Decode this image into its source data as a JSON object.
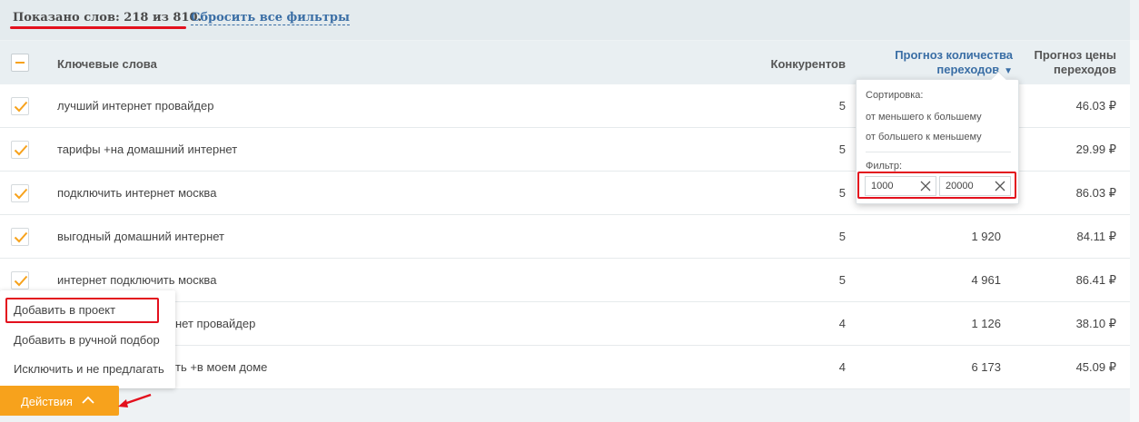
{
  "summary": {
    "shown_label": "Показано слов: 218 из 810.",
    "reset_filters": "Сбросить все фильтры"
  },
  "table": {
    "headers": {
      "keywords": "Ключевые слова",
      "competitors": "Конкурентов",
      "traffic_line1": "Прогноз количества",
      "traffic_line2": "переходов",
      "price_line1": "Прогноз цены",
      "price_line2": "переходов"
    },
    "rows": [
      {
        "keyword": "лучший интернет провайдер",
        "competitors": "5",
        "traffic": "",
        "price": "46.03 ₽"
      },
      {
        "keyword": "тарифы +на домашний интернет",
        "competitors": "5",
        "traffic": "",
        "price": "29.99 ₽"
      },
      {
        "keyword": "подключить интернет москва",
        "competitors": "5",
        "traffic": "",
        "price": "86.03 ₽"
      },
      {
        "keyword": "выгодный домашний интернет",
        "competitors": "5",
        "traffic": "1 920",
        "price": "84.11 ₽"
      },
      {
        "keyword": "интернет подключить москва",
        "competitors": "5",
        "traffic": "4 961",
        "price": "86.41 ₽"
      },
      {
        "keyword": "нет провайдер",
        "competitors": "4",
        "traffic": "1 126",
        "price": "38.10 ₽"
      },
      {
        "keyword": "ть +в моем доме",
        "competitors": "4",
        "traffic": "6 173",
        "price": "45.09 ₽"
      }
    ]
  },
  "sort_popover": {
    "sort_label": "Сортировка:",
    "asc": "от меньшего к большему",
    "desc": "от большего к меньшему",
    "filter_label": "Фильтр:",
    "min_value": "1000",
    "max_value": "20000"
  },
  "actions_menu": {
    "items": [
      "Добавить в проект",
      "Добавить в ручной подбор",
      "Исключить и не предлагать"
    ],
    "button_label": "Действия"
  },
  "colors": {
    "accent_orange": "#f7a21c",
    "link_blue": "#3a6ea5",
    "highlight_red": "#e3101d"
  }
}
